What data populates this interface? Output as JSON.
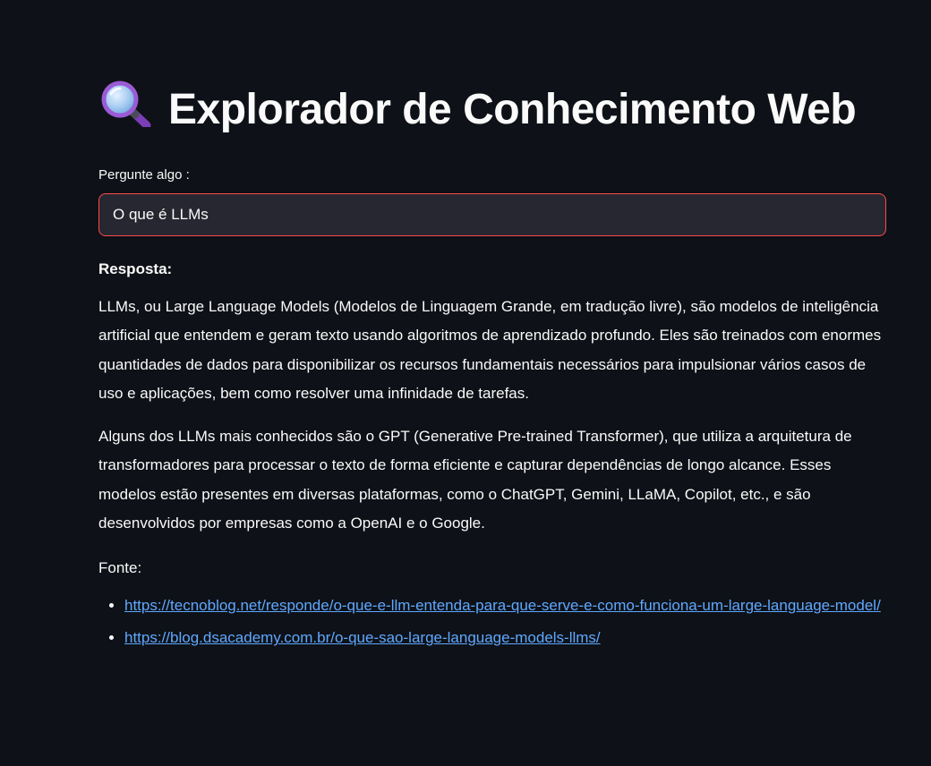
{
  "header": {
    "icon": "magnifying-glass-icon",
    "title": "Explorador de Conhecimento Web"
  },
  "query": {
    "label": "Pergunte algo :",
    "value": "O que é LLMs",
    "border_color": "#ff4b4b"
  },
  "answer": {
    "heading": "Resposta:",
    "paragraphs": [
      "LLMs, ou Large Language Models (Modelos de Linguagem Grande, em tradução livre), são modelos de inteligência artificial que entendem e geram texto usando algoritmos de aprendizado profundo. Eles são treinados com enormes quantidades de dados para disponibilizar os recursos fundamentais necessários para impulsionar vários casos de uso e aplicações, bem como resolver uma infinidade de tarefas.",
      "Alguns dos LLMs mais conhecidos são o GPT (Generative Pre-trained Transformer), que utiliza a arquitetura de transformadores para processar o texto de forma eficiente e capturar dependências de longo alcance. Esses modelos estão presentes em diversas plataformas, como o ChatGPT, Gemini, LLaMA, Copilot, etc., e são desenvolvidos por empresas como a OpenAI e o Google."
    ],
    "sources_label": "Fonte:",
    "sources": [
      "https://tecnoblog.net/responde/o-que-e-llm-entenda-para-que-serve-e-como-funciona-um-large-language-model/",
      "https://blog.dsacademy.com.br/o-que-sao-large-language-models-llms/"
    ]
  },
  "colors": {
    "background": "#0e1117",
    "input_background": "#262730",
    "link": "#5fa8ff"
  }
}
